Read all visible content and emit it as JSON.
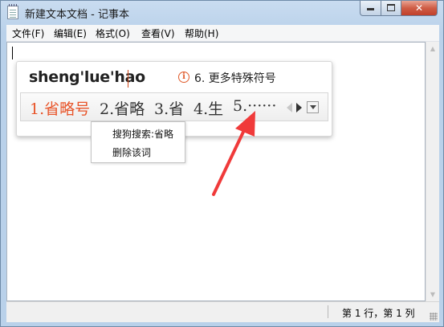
{
  "window": {
    "title": "新建文本文档 - 记事本",
    "buttons": {
      "minimize": "",
      "maximize": "",
      "close": "✕"
    }
  },
  "menubar": {
    "items": [
      {
        "label": "文件(F)"
      },
      {
        "label": "编辑(E)"
      },
      {
        "label": "格式(O)"
      },
      {
        "label": "查看(V)"
      },
      {
        "label": "帮助(H)"
      }
    ]
  },
  "editor": {
    "content": ""
  },
  "ime": {
    "pinyin": "sheng'lue'hao",
    "info_icon": "i",
    "more_symbols": "6. 更多特殊符号",
    "candidates": [
      {
        "label": "1.省略号",
        "selected": true
      },
      {
        "label": "2.省略"
      },
      {
        "label": "3.省"
      },
      {
        "label": "4.生"
      },
      {
        "label": "5.······"
      }
    ],
    "icons": [
      "info-icon",
      "page-prev-icon",
      "page-next-icon",
      "menu-dropdown-icon"
    ],
    "accent_color": "#e8552a"
  },
  "context_menu": {
    "items": [
      {
        "label": "搜狗搜索:省略"
      },
      {
        "label": "删除该词"
      }
    ]
  },
  "annotation": {
    "arrow_color": "#f03a3a"
  },
  "statusbar": {
    "position": "第 1 行，第 1 列"
  }
}
